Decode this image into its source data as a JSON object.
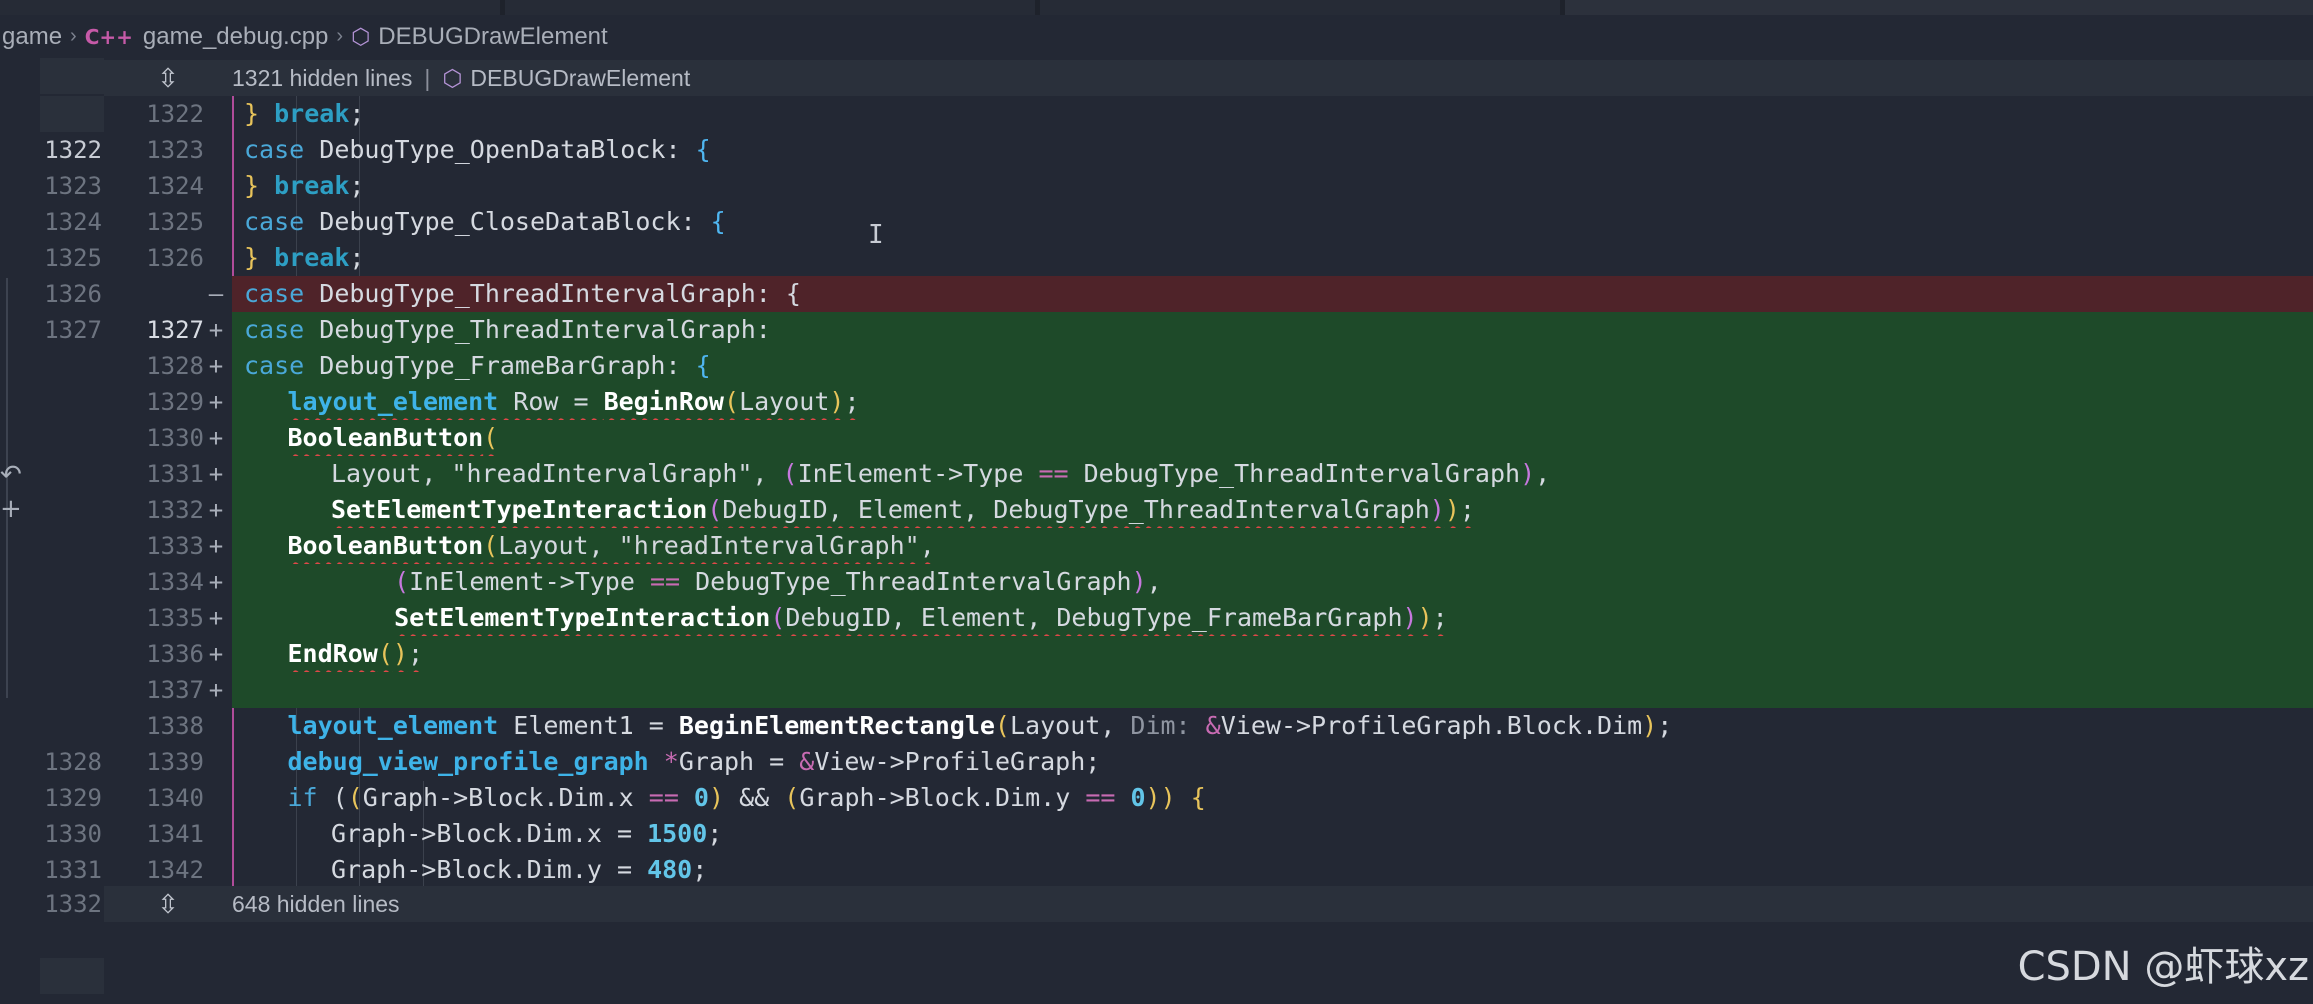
{
  "breadcrumb": {
    "root": "game",
    "file_icon": "C++",
    "file": "game_debug.cpp",
    "symbol": "DEBUGDrawElement"
  },
  "hidden_top": {
    "count_text": "1321 hidden lines",
    "separator": "|",
    "symbol": "DEBUGDrawElement"
  },
  "hidden_bottom": {
    "count_text": "648 hidden lines"
  },
  "watermark": "CSDN @虾球xz",
  "lines": [
    {
      "left": "",
      "right": "1322",
      "marker": "",
      "type": "normal"
    },
    {
      "left": "1322",
      "right": "1323",
      "marker": "",
      "type": "normal"
    },
    {
      "left": "1323",
      "right": "1324",
      "marker": "",
      "type": "normal"
    },
    {
      "left": "1324",
      "right": "1325",
      "marker": "",
      "type": "normal"
    },
    {
      "left": "1325",
      "right": "1326",
      "marker": "",
      "type": "normal"
    },
    {
      "left": "1326",
      "right": "",
      "marker": "—",
      "type": "removed"
    },
    {
      "left": "1327",
      "right": "1327",
      "marker": "+",
      "type": "added"
    },
    {
      "left": "",
      "right": "1328",
      "marker": "+",
      "type": "added"
    },
    {
      "left": "",
      "right": "1329",
      "marker": "+",
      "type": "added"
    },
    {
      "left": "",
      "right": "1330",
      "marker": "+",
      "type": "added"
    },
    {
      "left": "",
      "right": "1331",
      "marker": "+",
      "type": "added"
    },
    {
      "left": "",
      "right": "1332",
      "marker": "+",
      "type": "added"
    },
    {
      "left": "",
      "right": "1333",
      "marker": "+",
      "type": "added"
    },
    {
      "left": "",
      "right": "1334",
      "marker": "+",
      "type": "added"
    },
    {
      "left": "",
      "right": "1335",
      "marker": "+",
      "type": "added"
    },
    {
      "left": "",
      "right": "1336",
      "marker": "+",
      "type": "added"
    },
    {
      "left": "",
      "right": "1337",
      "marker": "+",
      "type": "added"
    },
    {
      "left": "",
      "right": "1338",
      "marker": "",
      "type": "normal"
    },
    {
      "left": "1328",
      "right": "1339",
      "marker": "",
      "type": "normal"
    },
    {
      "left": "1329",
      "right": "1340",
      "marker": "",
      "type": "normal"
    },
    {
      "left": "1330",
      "right": "1341",
      "marker": "",
      "type": "normal"
    },
    {
      "left": "1331",
      "right": "1342",
      "marker": "",
      "type": "normal"
    }
  ],
  "bottom_left_num": "1332",
  "code": {
    "l0": [
      "}",
      " break",
      ";"
    ],
    "l1": [
      "case",
      " DebugType_OpenDataBlock: ",
      "{"
    ],
    "l2": [
      "}",
      " break",
      ";"
    ],
    "l3": [
      "case",
      " DebugType_CloseDataBlock: ",
      "{"
    ],
    "l4": [
      "}",
      " break",
      ";"
    ],
    "l5": [
      "case",
      " DebugType_ThreadIntervalGraph: {"
    ],
    "l6": [
      "case",
      " DebugType_ThreadIntervalGraph:"
    ],
    "l7": [
      "case",
      " DebugType_FrameBarGraph: ",
      "{"
    ],
    "l8": [
      "layout_element",
      " Row = ",
      "BeginRow",
      "(",
      "Layout",
      ")",
      ";"
    ],
    "l9": [
      "BooleanButton",
      "("
    ],
    "l10": [
      "Layout, \"hreadIntervalGraph\", ",
      "(",
      "InElement->Type ",
      "==",
      " DebugType_ThreadIntervalGraph",
      ")",
      ","
    ],
    "l11": [
      "SetElementTypeInteraction",
      "(",
      "DebugID, Element, DebugType_ThreadIntervalGraph",
      ")",
      ")",
      ";"
    ],
    "l12": [
      "BooleanButton",
      "(",
      "Layout, ",
      "\"hreadIntervalGraph\"",
      ","
    ],
    "l13": [
      "(",
      "InElement->Type ",
      "==",
      " DebugType_ThreadIntervalGraph",
      ")",
      ","
    ],
    "l14": [
      "SetElementTypeInteraction",
      "(",
      "DebugID, Element, DebugType_FrameBarGraph",
      ")",
      ")",
      ";"
    ],
    "l15": [
      "EndRow",
      "(",
      ")",
      ";"
    ],
    "l16": [
      ""
    ],
    "l17": [
      "layout_element",
      " Element1 = ",
      "BeginElementRectangle",
      "(",
      "Layout, ",
      "Dim:",
      " &",
      "View->ProfileGraph.Block.Dim",
      ")",
      ";"
    ],
    "l18": [
      "debug_view_profile_graph",
      " *",
      "Graph = ",
      "&",
      "View->ProfileGraph;"
    ],
    "l19": [
      "if",
      " (",
      "(",
      "Graph->Block.Dim.x ",
      "==",
      " 0",
      ")",
      " && ",
      "(",
      "Graph->Block.Dim.y ",
      "==",
      " 0",
      ")",
      ")",
      " {"
    ],
    "l20": [
      "Graph->Block.Dim.x = ",
      "1500",
      ";"
    ],
    "l21": [
      "Graph->Block.Dim.y = ",
      "480",
      ";"
    ]
  }
}
